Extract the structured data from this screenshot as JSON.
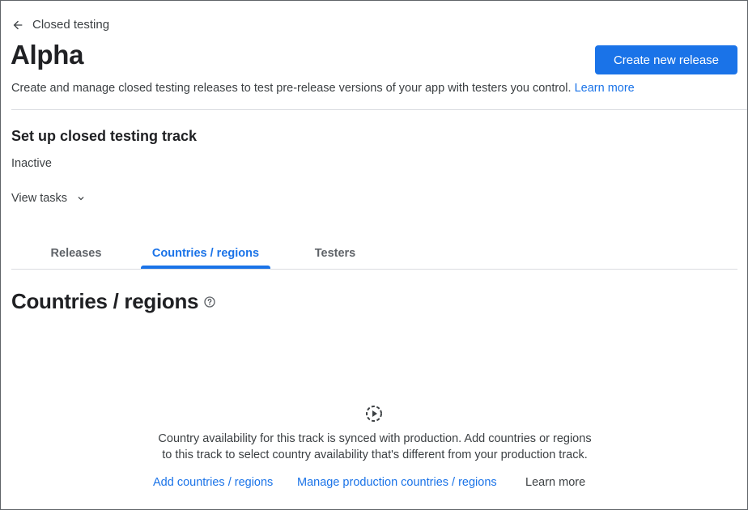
{
  "breadcrumb": {
    "label": "Closed testing",
    "icon": "arrow-back-icon"
  },
  "header": {
    "title": "Alpha",
    "primary_button": "Create new release",
    "subtitle": "Create and manage closed testing releases to test pre-release versions of your app with testers you control.",
    "subtitle_link": "Learn more"
  },
  "setup": {
    "title": "Set up closed testing track",
    "status": "Inactive",
    "view_tasks": "View tasks"
  },
  "tabs": [
    {
      "label": "Releases",
      "active": false
    },
    {
      "label": "Countries / regions",
      "active": true
    },
    {
      "label": "Testers",
      "active": false
    }
  ],
  "section": {
    "heading": "Countries / regions",
    "help_icon": "help-circle-icon",
    "empty_icon": "sync-play-icon",
    "message_line1": "Country availability for this track is synced with production. Add countries or regions",
    "message_line2": "to this track to select country availability that's different from your production track.",
    "actions": {
      "add": "Add countries / regions",
      "manage": "Manage production countries / regions",
      "learn_more": "Learn more"
    }
  },
  "colors": {
    "accent": "#1a73e8",
    "text_primary": "#202124",
    "text_secondary": "#3c4043",
    "divider": "#dadce0"
  }
}
